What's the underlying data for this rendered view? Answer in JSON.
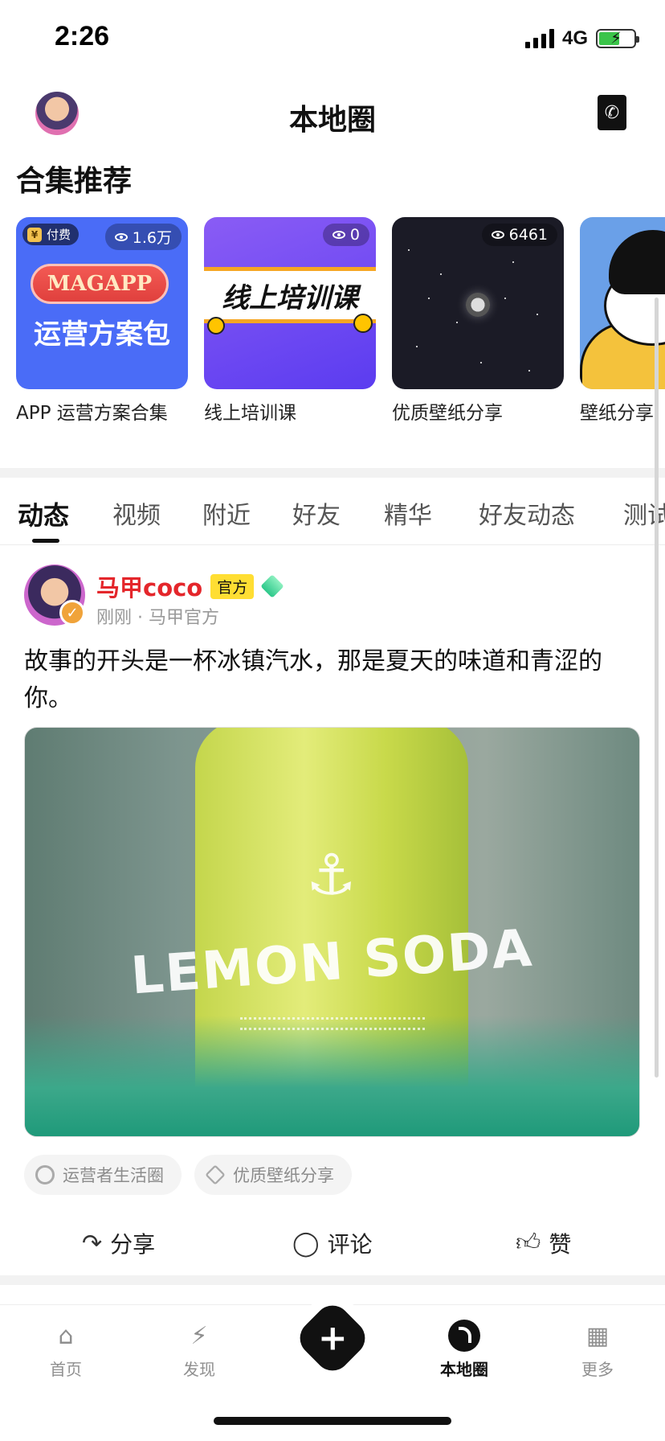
{
  "status_bar": {
    "time": "2:26",
    "network": "4G"
  },
  "header": {
    "title": "本地圈",
    "avatar_icon": "user-avatar",
    "phone_icon": "phone-icon"
  },
  "collections": {
    "title": "合集推荐",
    "items": [
      {
        "caption": "APP 运营方案合集",
        "views": "1.6万",
        "paid_label": "付费",
        "pill": "MAGAPP",
        "big": "运营方案包"
      },
      {
        "caption": "线上培训课",
        "views": "0",
        "banner": "线上培训课"
      },
      {
        "caption": "优质壁纸分享",
        "views": "6461"
      },
      {
        "caption": "壁纸分享"
      }
    ]
  },
  "tabs": [
    "动态",
    "视频",
    "附近",
    "好友",
    "精华",
    "好友动态",
    "测试"
  ],
  "post": {
    "author": "马甲coco",
    "badge": "官方",
    "meta": "刚刚 · 马甲官方",
    "text": "故事的开头是一杯冰镇汽水，那是夏天的味道和青涩的你。",
    "image_text": "LEMON SODA",
    "tags": [
      "运营者生活圈",
      "优质壁纸分享"
    ],
    "actions": {
      "share": "分享",
      "comment": "评论",
      "like": "赞"
    }
  },
  "bottom_nav": {
    "items": [
      "首页",
      "发现",
      "本地圈",
      "更多"
    ],
    "active": "本地圈"
  },
  "colors": {
    "accent": "#111111",
    "author": "#e4262b",
    "badge": "#ffde33"
  }
}
